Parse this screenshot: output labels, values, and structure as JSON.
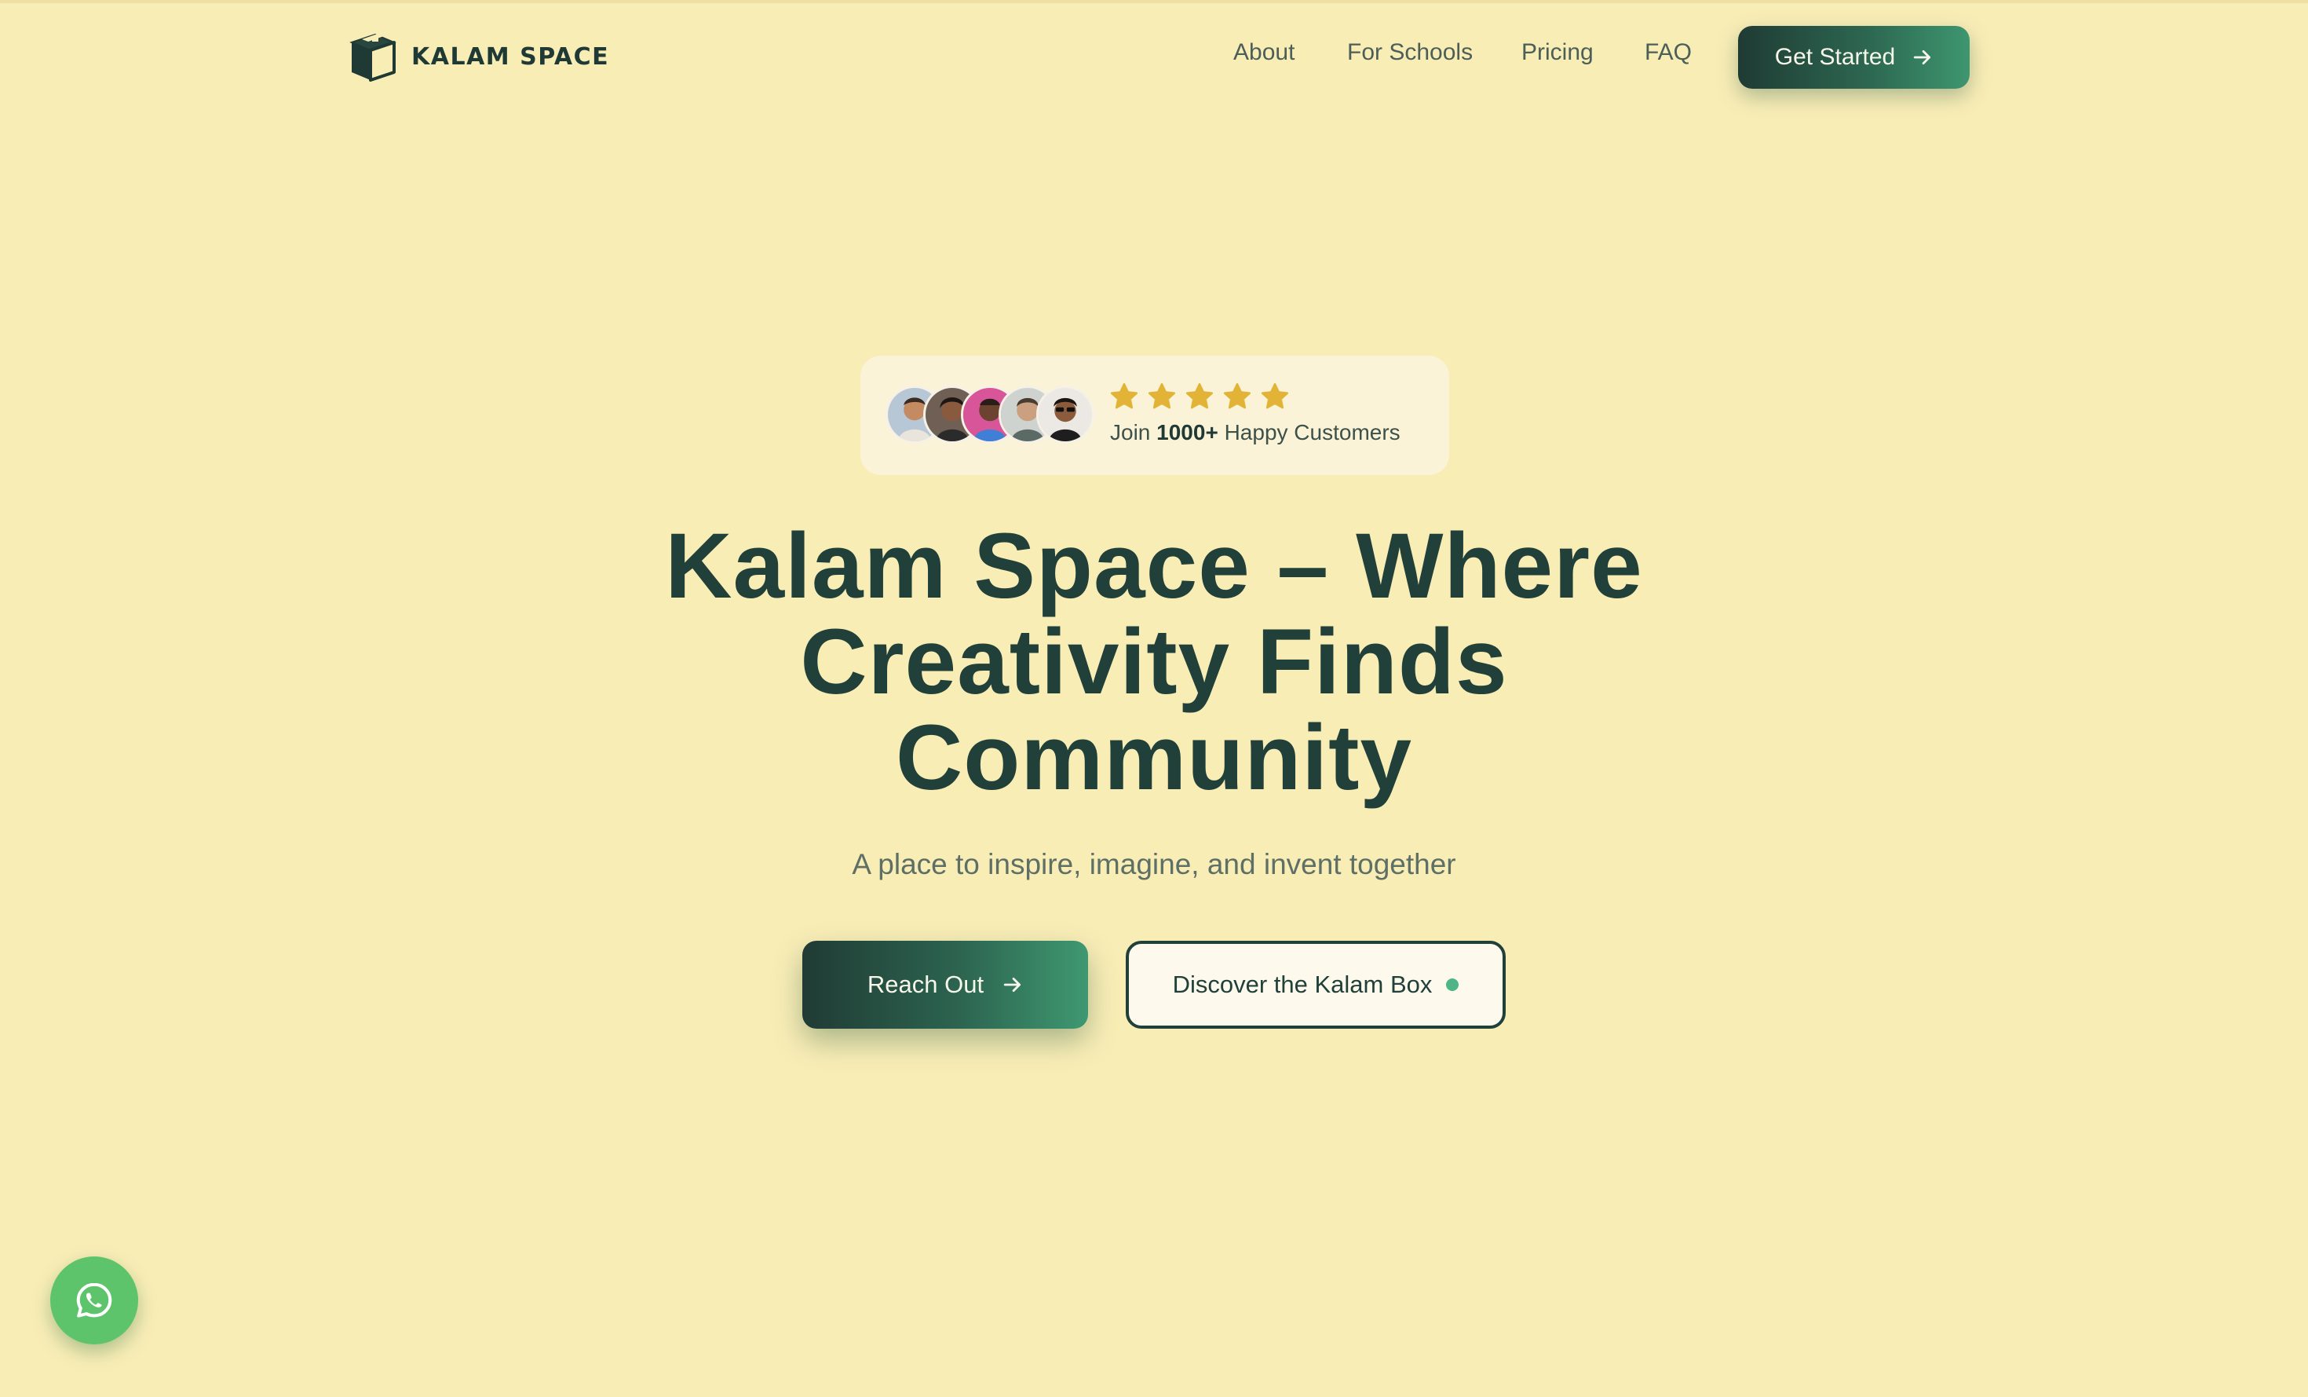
{
  "header": {
    "logo_text": "KALAM SPACE",
    "nav": {
      "about": "About",
      "for_schools": "For Schools",
      "pricing": "Pricing",
      "faq": "FAQ"
    },
    "cta_label": "Get Started"
  },
  "social_proof": {
    "rating_stars": 5,
    "text_prefix": "Join",
    "count": "1000+",
    "text_suffix": "Happy Customers",
    "avatar_count": 5
  },
  "hero": {
    "title_line1": "Kalam Space – Where",
    "title_line2": "Creativity Finds",
    "title_line3": "Community",
    "subtitle": "A place to inspire, imagine, and invent together",
    "primary_button": "Reach Out",
    "secondary_button": "Discover the Kalam Box"
  },
  "floating": {
    "icon": "whatsapp-icon"
  },
  "colors": {
    "background": "#f9edb6",
    "text_dark": "#22403a",
    "accent_green": "#3e9670",
    "star_gold": "#e2b336",
    "whatsapp_green": "#5ec46b"
  }
}
